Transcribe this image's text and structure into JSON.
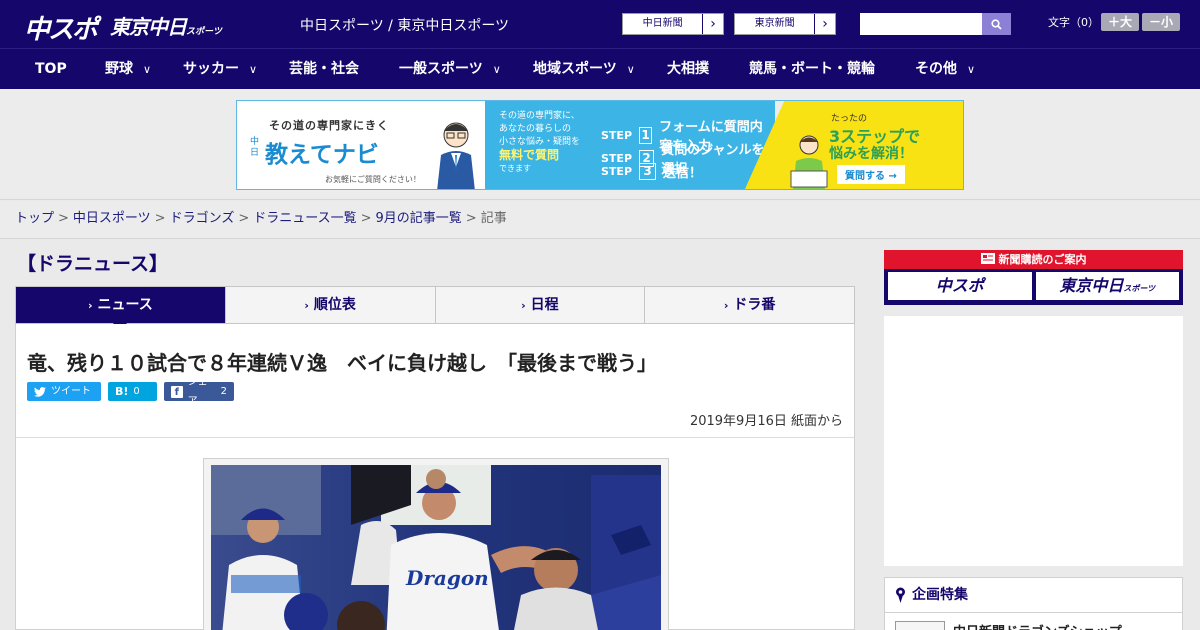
{
  "header": {
    "logo_chuspo": "中スポ",
    "logo_tokyo": "東京中日",
    "logo_tokyo_small": "スポーツ",
    "site_title": "中日スポーツ / 東京中日スポーツ",
    "paper_links": [
      {
        "label": "中日新聞",
        "arrow": "›"
      },
      {
        "label": "東京新聞",
        "arrow": "›"
      }
    ],
    "search_placeholder": "",
    "font_size_label": "文字（0）",
    "font_larger": "＋大",
    "font_smaller": "－小"
  },
  "nav": {
    "items": [
      {
        "label": "TOP",
        "has_menu": false
      },
      {
        "label": "野球",
        "has_menu": true
      },
      {
        "label": "サッカー",
        "has_menu": true
      },
      {
        "label": "芸能・社会",
        "has_menu": false
      },
      {
        "label": "一般スポーツ",
        "has_menu": true
      },
      {
        "label": "地域スポーツ",
        "has_menu": true
      },
      {
        "label": "大相撲",
        "has_menu": false
      },
      {
        "label": "競馬・ボート・競輪",
        "has_menu": false
      },
      {
        "label": "その他",
        "has_menu": true
      }
    ]
  },
  "banner": {
    "tagline": "その道の専門家にきく",
    "brand_prefix": "中日",
    "brand": "教えてナビ",
    "note": "お気軽にご質問ください！",
    "desc_line1": "その道の専門家に、",
    "desc_line2": "あなたの暮らしの",
    "desc_line3": "小さな悩み・疑問を",
    "desc_highlight": "無料で質問",
    "desc_line4": "できます",
    "steps": [
      {
        "label": "STEP",
        "num": "1",
        "text": "フォームに質問内容を入力"
      },
      {
        "label": "STEP",
        "num": "2",
        "text": "質問のジャンルを選択"
      },
      {
        "label": "STEP",
        "num": "3",
        "text": "送信！"
      }
    ],
    "right_top": "たったの",
    "right_big": "3ステップで",
    "right_big2": "悩みを解消！",
    "cta": "質問する →"
  },
  "breadcrumb": {
    "items": [
      "トップ",
      "中日スポーツ",
      "ドラゴンズ",
      "ドラニュース一覧",
      "9月の記事一覧"
    ],
    "current": "記事",
    "separator": ">"
  },
  "main": {
    "section_title": "【ドラニュース】",
    "tabs": [
      {
        "label": "ニュース",
        "active": true
      },
      {
        "label": "順位表",
        "active": false
      },
      {
        "label": "日程",
        "active": false
      },
      {
        "label": "ドラ番",
        "active": false
      }
    ],
    "headline": "竜、残り１０試合で８年連続Ｖ逸　ベイに負け越し　「最後まで戦う」",
    "share": {
      "tweet": "ツイート",
      "hatena_count": "0",
      "fb_label": "シェア",
      "fb_count": "2"
    },
    "dateline": "2019年9月16日 紙面から"
  },
  "sidebar": {
    "subscription_title": "新聞購読のご案内",
    "sub_left": "中スポ",
    "sub_right": "東京中日",
    "sub_right_small": "スポーツ",
    "feature_title": "企画特集",
    "feature_item": "中日新聞ドラゴンズショップ"
  },
  "colors": {
    "brand_navy": "#14066b",
    "accent_red": "#e0142c",
    "twitter": "#1da1f2",
    "hatena": "#00a4de",
    "facebook": "#3b5998",
    "banner_blue": "#3cb4e6",
    "banner_yellow": "#f8e214"
  }
}
